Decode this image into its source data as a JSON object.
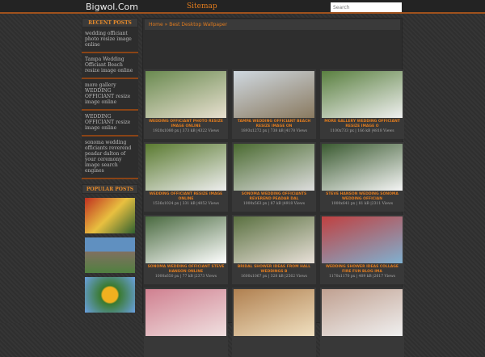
{
  "header": {
    "logo": "Bigwol.Com",
    "sitemap": "Sitemap",
    "search_placeholder": "Search"
  },
  "sidebar": {
    "recent_title": "RECENT POSTS",
    "recent": [
      "wedding officiant photo resize image online",
      "Tampa Wedding Officiant Beach resize image online",
      "more gallery WEDDING OFFICIANT resize image online",
      "WEDDING OFFICIANT resize image online",
      "sonoma wedding officiants reverend peadar dalton of your ceremony image search engines"
    ],
    "popular_title": "POPULAR POSTS"
  },
  "breadcrumb": "Home » Best Desktop Wallpaper",
  "cards": [
    {
      "title": "wedding officiant photo resize image online",
      "meta": "1920x1080 px | 373 kB |4322 Views",
      "c": [
        "#6a8a50",
        "#e8e0d0"
      ]
    },
    {
      "title": "Tampa wedding officiant beach resize image on",
      "meta": "1893x1272 px | 738 kB |4178 Views",
      "c": [
        "#cfd8e0",
        "#8a7a60"
      ]
    },
    {
      "title": "more gallery wedding officiant resize image o",
      "meta": "1100x733 px | 166 kB |4818 Views",
      "c": [
        "#5a8040",
        "#f0f0f0"
      ]
    },
    {
      "title": "wedding officiant resize image online",
      "meta": "1536x1024 px | 331 kB |4052 Views",
      "c": [
        "#5a7a30",
        "#eee"
      ]
    },
    {
      "title": "sonoma wedding officiants reverend peadar dal",
      "meta": "1000x563 px | 87 kB |4918 Views",
      "c": [
        "#4a6a30",
        "#ddd"
      ]
    },
    {
      "title": "steve hanson wedding sonoma wedding offician",
      "meta": "1000x641 px | 81 kB |2311 Views",
      "c": [
        "#3a5a30",
        "#f5f5f5"
      ]
    },
    {
      "title": "sonoma wedding officiant steve hanson online",
      "meta": "1000x650 px | 77 kB |2373 Views",
      "c": [
        "#4a6a40",
        "#fff"
      ]
    },
    {
      "title": "bridal shower ideas from hall weddings b",
      "meta": "1600x1067 px | 328 kB |2562 Views",
      "c": [
        "#5a7040",
        "#e8e0d8"
      ]
    },
    {
      "title": "wedding shower ideas collage fire fun blog ima",
      "meta": "1170x1170 px | 409 kB |2617 Views",
      "c": [
        "#c04040",
        "#80b0d0"
      ]
    },
    {
      "title": "",
      "meta": "",
      "c": [
        "#d08090",
        "#f0e0e0"
      ]
    },
    {
      "title": "",
      "meta": "",
      "c": [
        "#b08050",
        "#f0e0c0"
      ]
    },
    {
      "title": "",
      "meta": "",
      "c": [
        "#c0a090",
        "#f0f0f0"
      ]
    }
  ]
}
